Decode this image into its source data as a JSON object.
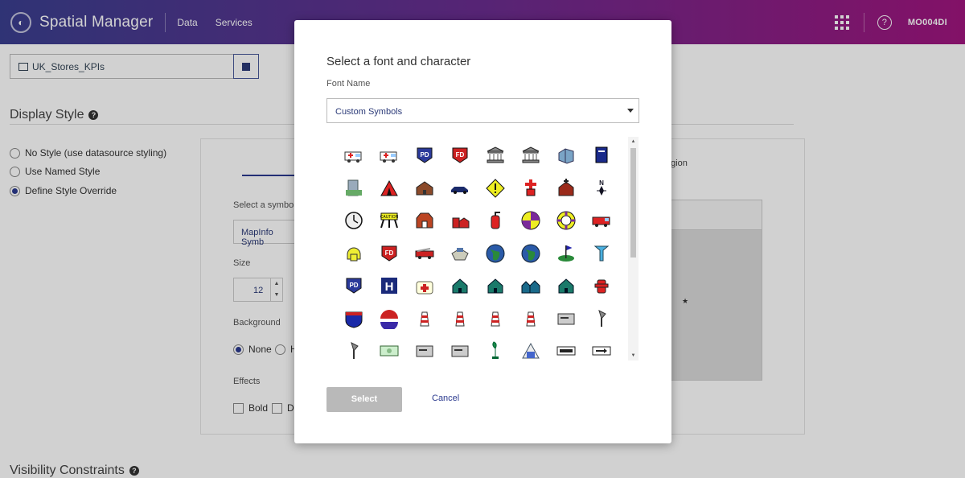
{
  "header": {
    "brand": "Spatial Manager",
    "nav": [
      "Data",
      "Services"
    ],
    "user": "MO004DI"
  },
  "datasource": {
    "value": "UK_Stores_KPIs"
  },
  "display_style": {
    "title": "Display Style",
    "options": [
      "No Style (use datasource styling)",
      "Use Named Style",
      "Define Style Override"
    ],
    "selected_index": 2,
    "tab_region": "egion",
    "symbol_label": "Select a symbo",
    "symbol_value": "MapInfo Symb",
    "size_label": "Size",
    "size_value": "12",
    "background_label": "Background",
    "background_options": [
      "None",
      "H"
    ],
    "effects_label": "Effects",
    "effects_options": [
      "Bold",
      "D"
    ]
  },
  "visibility": {
    "title": "Visibility Constraints"
  },
  "modal": {
    "title": "Select a font and character",
    "font_label": "Font Name",
    "font_value": "Custom Symbols",
    "select_button": "Select",
    "cancel_button": "Cancel",
    "symbols": [
      "ambulance",
      "ambulance-2",
      "police-badge",
      "fire-dept-badge",
      "bank",
      "bank-2",
      "building",
      "book",
      "office-building",
      "tent",
      "cabin",
      "car",
      "warning-sign",
      "cross",
      "church",
      "compass",
      "clock",
      "construction",
      "barn",
      "farm",
      "fire-extinguisher",
      "quadrant-target",
      "life-ring",
      "fire-truck",
      "fire-helmet",
      "fire-dept-badge-2",
      "fire-engine",
      "ship",
      "globe",
      "globe-2",
      "golf-flag",
      "golf-tee",
      "police-badge-2",
      "hospital",
      "first-aid-kit",
      "house",
      "house-2",
      "houses",
      "house-3",
      "fire-hydrant",
      "interstate-shield",
      "us-highway-shield",
      "lighthouse",
      "lighthouse-2",
      "lighthouse-3",
      "lighthouse-4",
      "mailbox",
      "lamp",
      "lamp-2",
      "money",
      "mailbox-2",
      "mailbox-3",
      "plant",
      "museum",
      "dollar-bill",
      "arrow-bill"
    ]
  }
}
